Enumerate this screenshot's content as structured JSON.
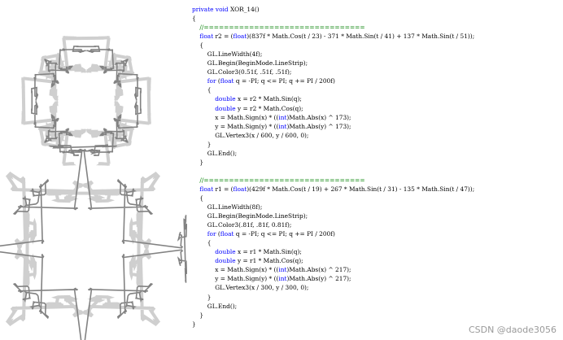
{
  "code_lines": [
    [
      {
        "t": "private void XOR_14()",
        "k": "kw_first"
      }
    ],
    [
      {
        "t": "{"
      }
    ],
    [
      {
        "t": "    //================================",
        "c": "cm"
      }
    ],
    [
      {
        "t": "    "
      },
      {
        "t": "float",
        "c": "kw"
      },
      {
        "t": " r2 = ("
      },
      {
        "t": "float",
        "c": "kw"
      },
      {
        "t": ")(837f * Math.Cos(t / 23) - 371 * Math.Sin(t / 41) + 137 * Math.Sin(t / 51));"
      }
    ],
    [
      {
        "t": "    {"
      }
    ],
    [
      {
        "t": "        GL.LineWidth(4f);"
      }
    ],
    [
      {
        "t": "        GL.Begin(BeginMode.LineStrip);"
      }
    ],
    [
      {
        "t": "        GL.Color3(0.51f, .51f, .51f);"
      }
    ],
    [
      {
        "t": "        "
      },
      {
        "t": "for",
        "c": "kw"
      },
      {
        "t": " ("
      },
      {
        "t": "float",
        "c": "kw"
      },
      {
        "t": " q = -PI; q <= PI; q += PI / 200f)"
      }
    ],
    [
      {
        "t": "        {"
      }
    ],
    [
      {
        "t": "            "
      },
      {
        "t": "double",
        "c": "kw"
      },
      {
        "t": " x = r2 * Math.Sin(q);"
      }
    ],
    [
      {
        "t": "            "
      },
      {
        "t": "double",
        "c": "kw"
      },
      {
        "t": " y = r2 * Math.Cos(q);"
      }
    ],
    [
      {
        "t": "            x = Math.Sign(x) * (("
      },
      {
        "t": "int",
        "c": "kw"
      },
      {
        "t": ")Math.Abs(x) ^ 173);"
      }
    ],
    [
      {
        "t": "            y = Math.Sign(y) * (("
      },
      {
        "t": "int",
        "c": "kw"
      },
      {
        "t": ")Math.Abs(y) ^ 173);"
      }
    ],
    [
      {
        "t": "            GL.Vertex3(x / 600, y / 600, 0);"
      }
    ],
    [
      {
        "t": "        }"
      }
    ],
    [
      {
        "t": "        GL.End();"
      }
    ],
    [
      {
        "t": "    }"
      }
    ],
    [
      {
        "t": ""
      }
    ],
    [
      {
        "t": "    //================================",
        "c": "cm"
      }
    ],
    [
      {
        "t": "    "
      },
      {
        "t": "float",
        "c": "kw"
      },
      {
        "t": " r1 = ("
      },
      {
        "t": "float",
        "c": "kw"
      },
      {
        "t": ")(429f * Math.Cos(t / 19) + 267 * Math.Sin(t / 31) - 135 * Math.Sin(t / 47));"
      }
    ],
    [
      {
        "t": "    {"
      }
    ],
    [
      {
        "t": "        GL.LineWidth(8f);"
      }
    ],
    [
      {
        "t": "        GL.Begin(BeginMode.LineStrip);"
      }
    ],
    [
      {
        "t": "        GL.Color3(.81f, .81f, 0.81f);"
      }
    ],
    [
      {
        "t": "        "
      },
      {
        "t": "for",
        "c": "kw"
      },
      {
        "t": " ("
      },
      {
        "t": "float",
        "c": "kw"
      },
      {
        "t": " q = -PI; q <= PI; q += PI / 200f)"
      }
    ],
    [
      {
        "t": "        {"
      }
    ],
    [
      {
        "t": "            "
      },
      {
        "t": "double",
        "c": "kw"
      },
      {
        "t": " x = r1 * Math.Sin(q);"
      }
    ],
    [
      {
        "t": "            "
      },
      {
        "t": "double",
        "c": "kw"
      },
      {
        "t": " y = r1 * Math.Cos(q);"
      }
    ],
    [
      {
        "t": "            x = Math.Sign(x) * (("
      },
      {
        "t": "int",
        "c": "kw"
      },
      {
        "t": ")Math.Abs(x) ^ 217);"
      }
    ],
    [
      {
        "t": "            y = Math.Sign(y) * (("
      },
      {
        "t": "int",
        "c": "kw"
      },
      {
        "t": ")Math.Abs(y) ^ 217);"
      }
    ],
    [
      {
        "t": "            GL.Vertex3(x / 300, y / 300, 0);"
      }
    ],
    [
      {
        "t": "        }"
      }
    ],
    [
      {
        "t": "        GL.End();"
      }
    ],
    [
      {
        "t": "    }"
      }
    ],
    [
      {
        "t": "}"
      }
    ]
  ],
  "watermark": "CSDN @daode3056",
  "colors": {
    "keyword": "#0000ff",
    "comment": "#008000",
    "text": "#000000",
    "figure_dark": "#828282",
    "figure_light": "#cfcfcf"
  }
}
